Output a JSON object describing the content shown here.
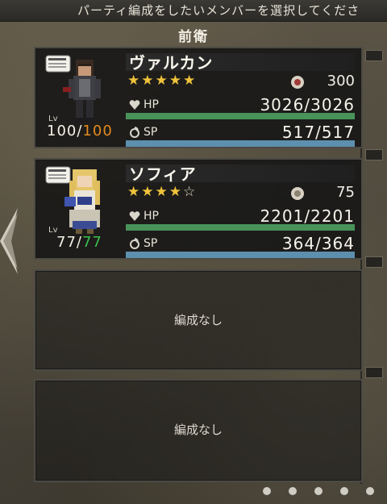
{
  "header": {
    "instruction": "パーティ編成をしたいメンバーを選択してくださ"
  },
  "section": {
    "title": "前衛"
  },
  "slots": [
    {
      "name": "ヴァルカン",
      "rarity": 5,
      "max_rarity": 5,
      "star_filled": "★★★★★",
      "star_empty": "",
      "level_label": "Lv",
      "level": "100/",
      "level_max": "100",
      "token_value": "300",
      "hp_label": "HP",
      "hp": "3026/3026",
      "hp_ratio": 1.0,
      "sp_label": "SP",
      "sp": "517/517",
      "sp_ratio": 1.0
    },
    {
      "name": "ソフィア",
      "rarity": 4,
      "max_rarity": 5,
      "star_filled": "★★★★",
      "star_empty": "☆",
      "level_label": "Lv",
      "level": "77/",
      "level_max": "77",
      "token_value": "75",
      "hp_label": "HP",
      "hp": "2201/2201",
      "hp_ratio": 1.0,
      "sp_label": "SP",
      "sp": "364/364",
      "sp_ratio": 1.0
    },
    {
      "empty_label": "編成なし"
    },
    {
      "empty_label": "編成なし"
    }
  ],
  "page_indicator": {
    "count": 5
  },
  "colors": {
    "hp_bar": "#49925a",
    "sp_bar": "#5d8fae",
    "stars": "#f1c33b",
    "level_max_orange": "#e38a1c",
    "level_max_green": "#3bbf4f"
  }
}
